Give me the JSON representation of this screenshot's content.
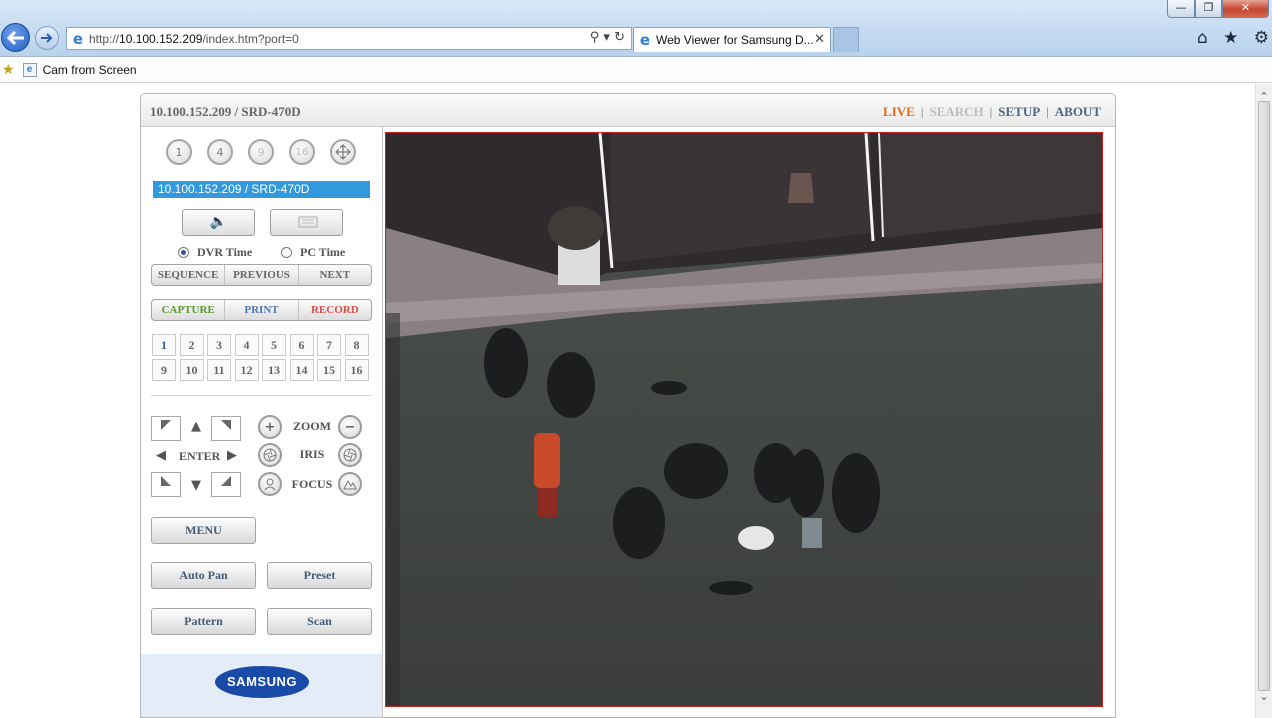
{
  "browser": {
    "url_prefix": "http://",
    "url_host": "10.100.152.209",
    "url_path": "/index.htm?port=0",
    "tab_title": "Web Viewer for Samsung D...",
    "favorite_item": "Cam from Screen"
  },
  "viewer": {
    "title": "10.100.152.209 / SRD-470D",
    "nav": {
      "live": "LIVE",
      "search": "SEARCH",
      "setup": "SETUP",
      "about": "ABOUT",
      "sep": "|"
    },
    "split_buttons": [
      "1",
      "4",
      "9",
      "16"
    ],
    "camera_name": "10.100.152.209  / SRD-470D",
    "time_modes": {
      "dvr": "DVR Time",
      "pc": "PC Time",
      "selected": "dvr"
    },
    "seq_bar": {
      "sequence": "SEQUENCE",
      "previous": "PREVIOUS",
      "next": "NEXT"
    },
    "action_bar": {
      "capture": "CAPTURE",
      "print": "PRINT",
      "record": "RECORD"
    },
    "channels": [
      "1",
      "2",
      "3",
      "4",
      "5",
      "6",
      "7",
      "8",
      "9",
      "10",
      "11",
      "12",
      "13",
      "14",
      "15",
      "16"
    ],
    "active_channel": "1",
    "ptz": {
      "enter": "ENTER",
      "zoom": "ZOOM",
      "iris": "IRIS",
      "focus": "FOCUS"
    },
    "buttons": {
      "menu": "MENU",
      "auto_pan": "Auto Pan",
      "preset": "Preset",
      "pattern": "Pattern",
      "scan": "Scan"
    },
    "brand": "SAMSUNG"
  },
  "colors": {
    "live": "#e46b14",
    "accent_blue": "#3399dd",
    "frame_red": "#cc2222"
  }
}
